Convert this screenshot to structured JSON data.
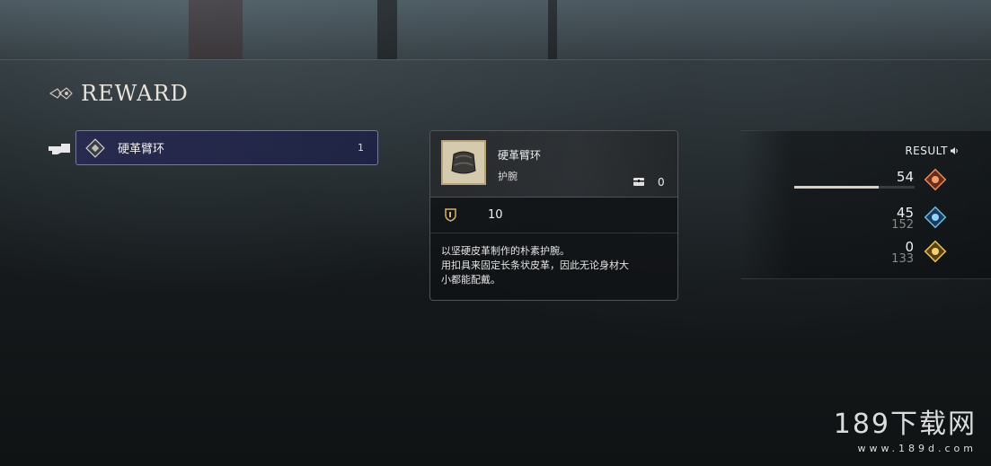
{
  "header": {
    "title": "REWARD"
  },
  "reward_list": [
    {
      "name": "硬革臂环",
      "quantity": "1"
    }
  ],
  "detail": {
    "item_name": "硬革臂环",
    "item_type": "护腕",
    "owned_count": "0",
    "defense_value": "10",
    "description_lines": [
      "以坚硬皮革制作的朴素护腕。",
      "用扣具来固定长条状皮革，因此无论身材大",
      "小都能配戴。"
    ]
  },
  "result": {
    "label": "RESULT",
    "rows": [
      {
        "value": "54",
        "sub": "",
        "icon": "orange-gem-icon",
        "progress": 0.7
      },
      {
        "value": "45",
        "sub": "152",
        "icon": "blue-gem-icon"
      },
      {
        "value": "0",
        "sub": "133",
        "icon": "gold-coin-icon"
      }
    ]
  },
  "watermark": {
    "main": "189下载网",
    "sub": "www.189d.com"
  },
  "colors": {
    "selection_bg": "#282a50",
    "accent_border": "#b4bee6"
  }
}
